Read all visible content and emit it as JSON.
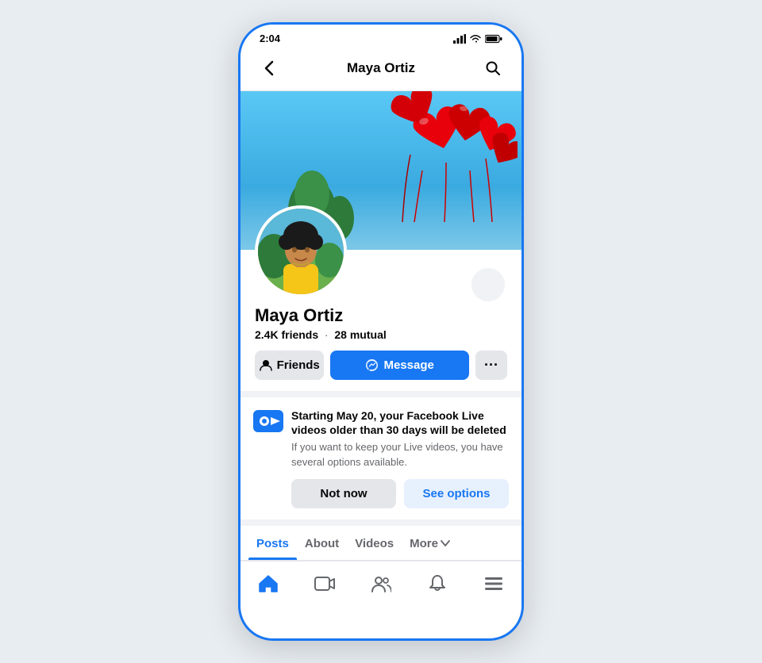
{
  "statusBar": {
    "time": "2:04",
    "signalIcon": "signal-icon",
    "wifiIcon": "wifi-icon",
    "batteryIcon": "battery-icon"
  },
  "topNav": {
    "backLabel": "‹",
    "title": "Maya Ortiz",
    "searchLabel": "🔍"
  },
  "profile": {
    "name": "Maya Ortiz",
    "friendsCount": "2.4K",
    "friendsLabel": "friends",
    "mutualCount": "28",
    "mutualLabel": "mutual"
  },
  "actionButtons": {
    "friendsLabel": "Friends",
    "messageLabel": "Message",
    "moreLabel": "···"
  },
  "banner": {
    "title": "Starting May 20, your Facebook Live videos older than 30 days will be deleted",
    "subtitle": "If you want to keep your Live videos, you have several options available.",
    "notNowLabel": "Not now",
    "seeOptionsLabel": "See options"
  },
  "tabs": {
    "items": [
      {
        "label": "Posts",
        "active": true
      },
      {
        "label": "About",
        "active": false
      },
      {
        "label": "Videos",
        "active": false
      },
      {
        "label": "More",
        "active": false
      }
    ]
  },
  "bottomNav": {
    "items": [
      {
        "name": "home",
        "active": true
      },
      {
        "name": "video",
        "active": false
      },
      {
        "name": "friends",
        "active": false
      },
      {
        "name": "bell",
        "active": false
      },
      {
        "name": "menu",
        "active": false
      }
    ]
  }
}
